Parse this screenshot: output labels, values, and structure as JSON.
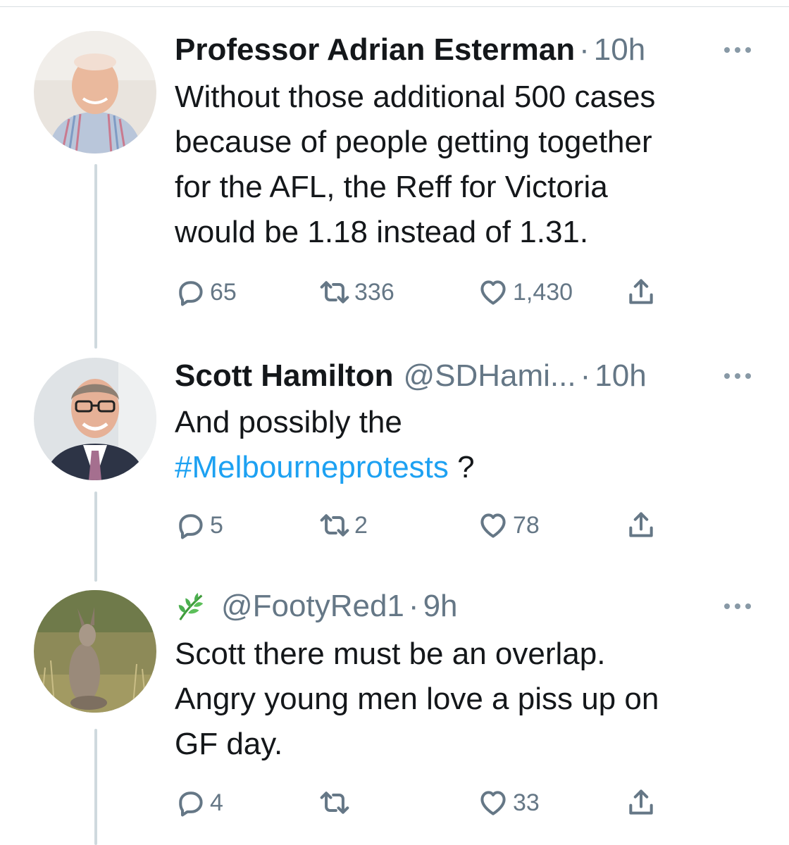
{
  "tweets": [
    {
      "name": "Professor Adrian Esterman",
      "handle": "",
      "separator": "·",
      "time": "10h",
      "text_lines": [
        "Without those additional 500 cases",
        "because of people getting together",
        "for the AFL, the Reff for Victoria",
        "would be 1.18 instead of 1.31."
      ],
      "replies": "65",
      "retweets": "336",
      "likes": "1,430"
    },
    {
      "name": "Scott Hamilton",
      "handle": "@SDHami...",
      "separator": "·",
      "time": "10h",
      "text_line1": "And possibly the",
      "hashtag": "#Melbourneprotests",
      "text_after_hashtag": " ?",
      "replies": "5",
      "retweets": "2",
      "likes": "78"
    },
    {
      "name": "",
      "handle": "@FootyRed1",
      "separator": "·",
      "time": "9h",
      "text_lines": [
        "Scott there must be an overlap.",
        "Angry young men love a piss up on",
        "GF day."
      ],
      "replies": "4",
      "retweets": "",
      "likes": "33"
    }
  ],
  "icons": {
    "reply": "reply-icon",
    "retweet": "retweet-icon",
    "like": "heart-icon",
    "share": "share-icon",
    "more": "more-options-icon",
    "name_emoji": "herb-leaf-icon"
  },
  "colors": {
    "text": "#14171a",
    "secondary": "#657786",
    "link": "#1da1f2",
    "thread_line": "#cfd9de"
  }
}
